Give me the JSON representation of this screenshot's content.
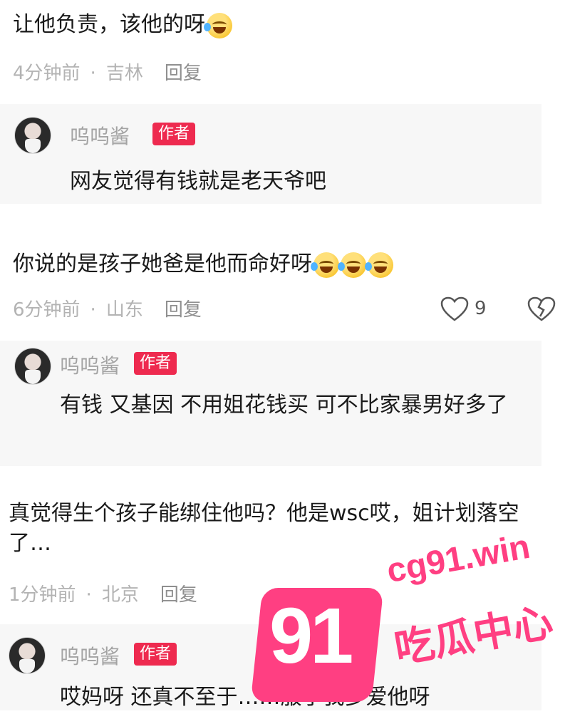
{
  "comments": [
    {
      "text": "让他负责，该他的呀",
      "time": "4分钟前",
      "location": "吉林",
      "reply_label": "回复",
      "reply": {
        "author": "呜呜酱",
        "badge": "作者",
        "text": "网友觉得有钱就是老天爷吧"
      }
    },
    {
      "text": "你说的是孩子她爸是他而命好呀",
      "time": "6分钟前",
      "location": "山东",
      "reply_label": "回复",
      "likes": "9",
      "reply": {
        "author": "呜呜酱",
        "badge": "作者",
        "text": "有钱 又基因 不用姐花钱买 可不比家暴男好多了"
      }
    },
    {
      "text": "真觉得生个孩子能绑住他吗？他是wsc哎，姐计划落空了…",
      "time": "1分钟前",
      "location": "北京",
      "reply_label": "回复",
      "reply": {
        "author": "呜呜酱",
        "badge": "作者",
        "text": "哎妈呀 还真不至于……服了我多爱他呀"
      }
    }
  ],
  "watermark": {
    "number": "91",
    "site": "cg91.win",
    "tagline": "吃瓜中心"
  },
  "colors": {
    "badge": "#ee2a4f",
    "watermark": "#ff3f82",
    "meta": "#b3b3b3"
  }
}
